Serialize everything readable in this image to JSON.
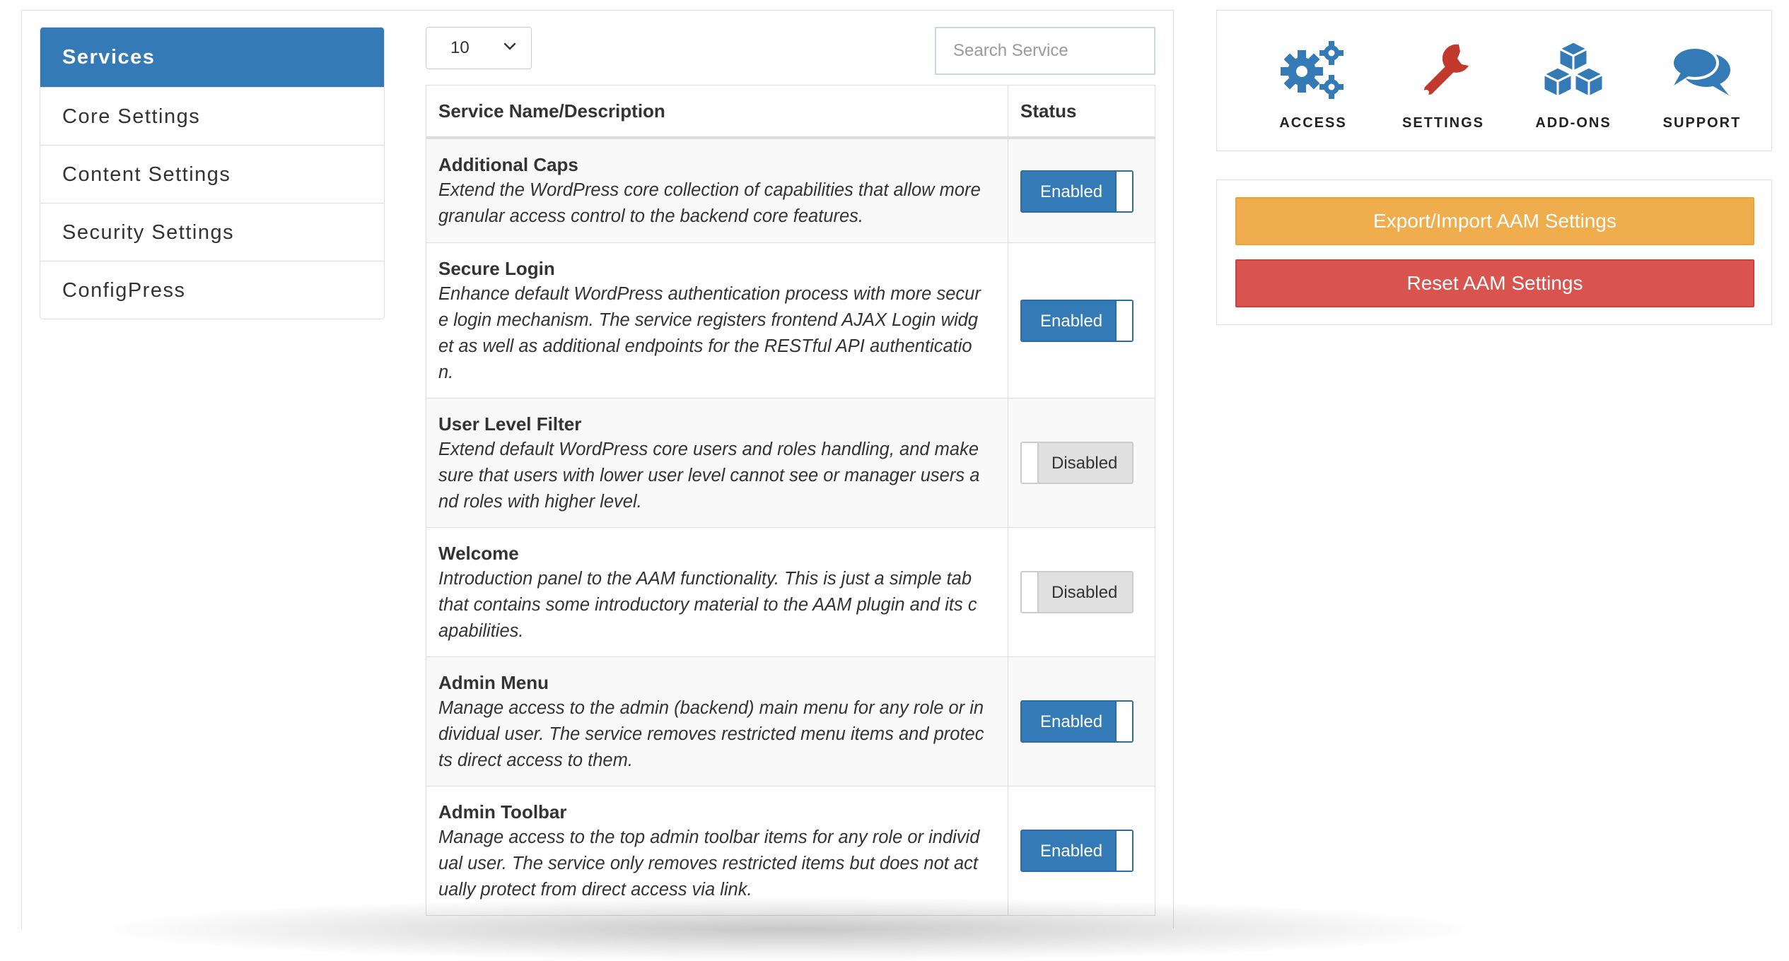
{
  "sidebar": {
    "items": [
      {
        "label": "Services",
        "active": true
      },
      {
        "label": "Core Settings",
        "active": false
      },
      {
        "label": "Content Settings",
        "active": false
      },
      {
        "label": "Security Settings",
        "active": false
      },
      {
        "label": "ConfigPress",
        "active": false
      }
    ]
  },
  "table_controls": {
    "length_value": "10",
    "search_placeholder": "Search Service"
  },
  "table": {
    "headers": [
      "Service Name/Description",
      "Status"
    ],
    "rows": [
      {
        "name": "Additional Caps",
        "desc_lines": [
          "Extend the WordPress core collection of capabilities that allow more",
          "granular access control to the backend core features."
        ],
        "status": "Enabled"
      },
      {
        "name": "Secure Login",
        "desc_lines": [
          "Enhance default WordPress authentication process with more secur",
          "e login mechanism. The service registers frontend AJAX Login widg",
          "et as well as additional endpoints for the RESTful API authenticatio",
          "n."
        ],
        "status": "Enabled"
      },
      {
        "name": "User Level Filter",
        "desc_lines": [
          "Extend default WordPress core users and roles handling, and make",
          "sure that users with lower user level cannot see or manager users a",
          "nd roles with higher level."
        ],
        "status": "Disabled"
      },
      {
        "name": "Welcome",
        "desc_lines": [
          "Introduction panel to the AAM functionality. This is just a simple tab",
          "that contains some introductory material to the AAM plugin and its c",
          "apabilities."
        ],
        "status": "Disabled"
      },
      {
        "name": "Admin Menu",
        "desc_lines": [
          "Manage access to the admin (backend) main menu for any role or in",
          "dividual user. The service removes restricted menu items and protec",
          "ts direct access to them."
        ],
        "status": "Enabled"
      },
      {
        "name": "Admin Toolbar",
        "desc_lines": [
          "Manage access to the top admin toolbar items for any role or individ",
          "ual user. The service only removes restricted items but does not act",
          "ually protect from direct access via link."
        ],
        "status": "Enabled"
      }
    ]
  },
  "nav": {
    "items": [
      {
        "label": "ACCESS",
        "icon": "gears-icon",
        "color": "#337ab7"
      },
      {
        "label": "SETTINGS",
        "icon": "wrench-icon",
        "color": "#c0392b"
      },
      {
        "label": "ADD-ONS",
        "icon": "cubes-icon",
        "color": "#337ab7"
      },
      {
        "label": "SUPPORT",
        "icon": "comments-icon",
        "color": "#337ab7"
      }
    ]
  },
  "actions": {
    "export_label": "Export/Import AAM Settings",
    "reset_label": "Reset AAM Settings"
  },
  "colors": {
    "primary": "#337ab7",
    "warning": "#f0ad4e",
    "danger": "#d9534f",
    "disabled_bg": "#e0e0e0"
  }
}
